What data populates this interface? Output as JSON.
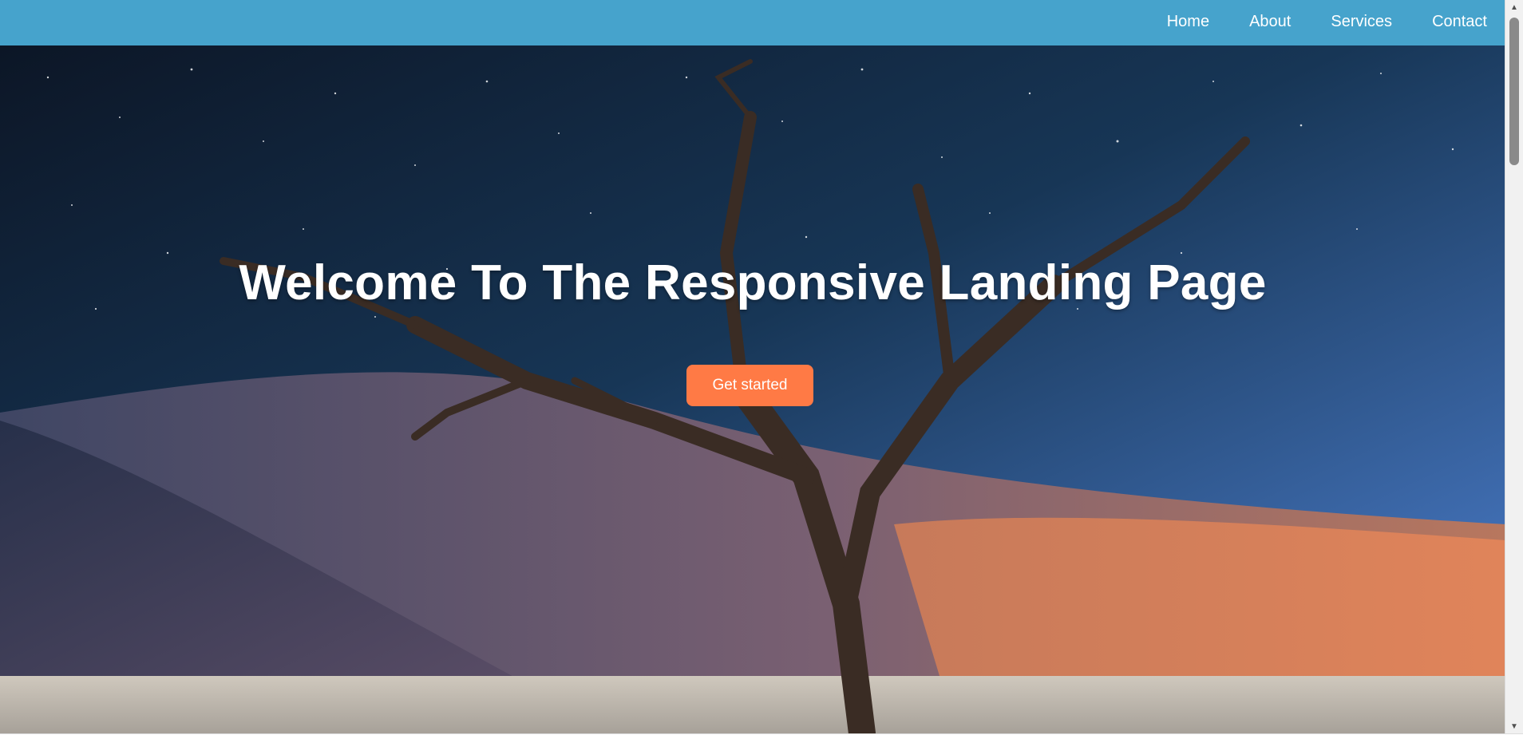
{
  "nav": {
    "items": [
      {
        "label": "Home"
      },
      {
        "label": "About"
      },
      {
        "label": "Services"
      },
      {
        "label": "Contact"
      }
    ]
  },
  "hero": {
    "title": "Welcome To The Responsive Landing Page",
    "cta_label": "Get started"
  },
  "colors": {
    "navbar": "#46a3cc",
    "cta": "#ff7a45",
    "text": "#ffffff"
  },
  "icons": {
    "scroll_up": "triangle-up",
    "scroll_down": "triangle-down"
  }
}
